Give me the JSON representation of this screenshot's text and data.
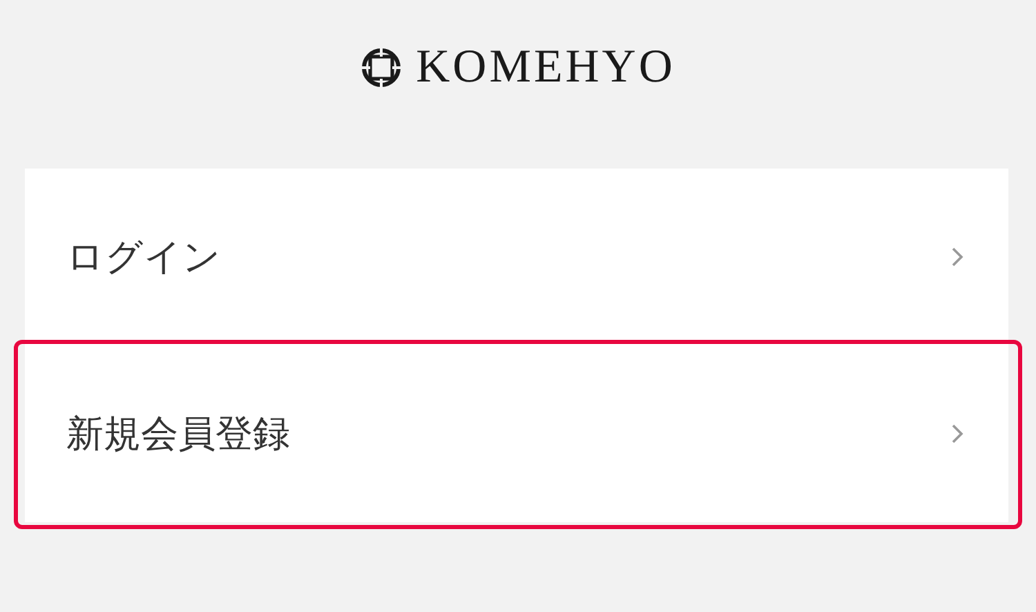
{
  "logo": {
    "text": "KOMEHYO"
  },
  "menu": [
    {
      "label": "ログイン",
      "highlighted": false
    },
    {
      "label": "新規会員登録",
      "highlighted": true
    }
  ]
}
